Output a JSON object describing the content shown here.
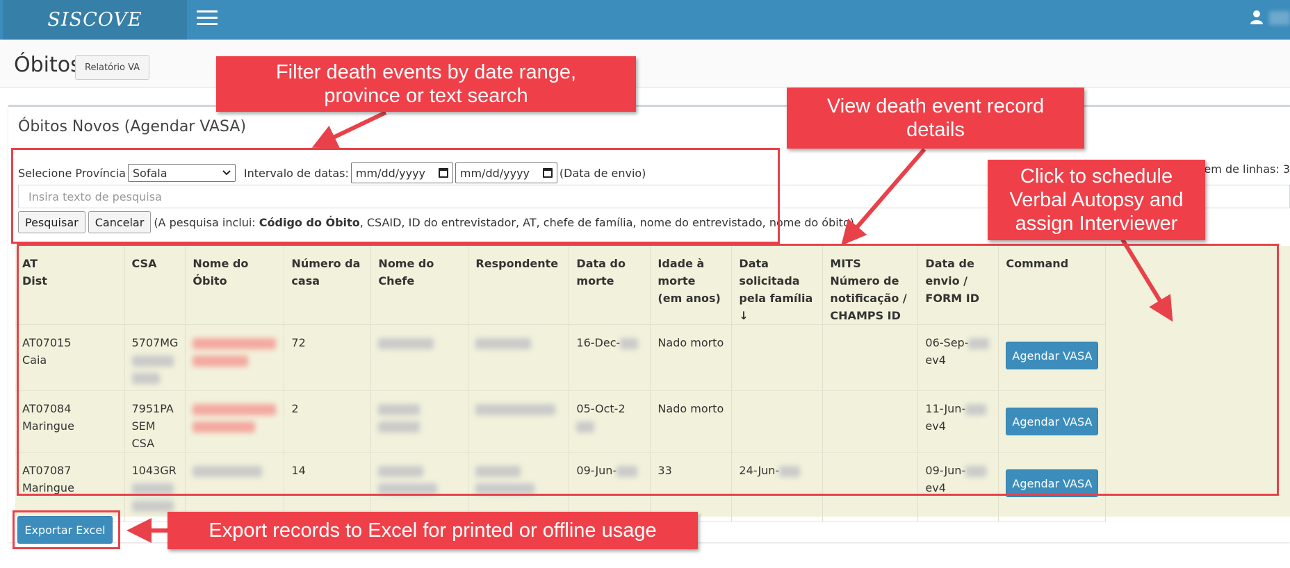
{
  "app": {
    "brand": "SISCOVE"
  },
  "header": {
    "title": "Óbitos",
    "report_button": "Relatório VA"
  },
  "box": {
    "title": "Óbitos Novos (Agendar VASA)"
  },
  "filters": {
    "province_label": "Selecione Província",
    "province_value": "Sofala",
    "date_range_label": "Intervalo de datas:",
    "date_from": "mm/dd/yyyy",
    "date_to": "mm/dd/yyyy",
    "date_note": "(Data de envio)",
    "search_placeholder": "Insira texto de pesquisa",
    "search_button": "Pesquisar",
    "cancel_button": "Cancelar",
    "search_hint_prefix": "(A pesquisa inclui:",
    "search_hint_bold": "Código do Óbito",
    "search_hint_rest": ", CSAID, ID do entrevistador, AT, chefe de família, nome do entrevistado, nome do óbito)",
    "rows_label": "gem de linhas: 3"
  },
  "table": {
    "columns": [
      {
        "line1": "AT",
        "line2": "Dist"
      },
      {
        "line1": "CSA"
      },
      {
        "line1": "Nome do Óbito"
      },
      {
        "line1": "Número da casa"
      },
      {
        "line1": "Nome do Chefe"
      },
      {
        "line1": "Respondente"
      },
      {
        "line1": "Data do morte"
      },
      {
        "line1": "Idade à morte",
        "line2": "(em anos)"
      },
      {
        "line1": "Data solicitada",
        "line2": "pela família ↓"
      },
      {
        "line1": "MITS Número de",
        "line2": "notificação /",
        "line3": "CHAMPS ID"
      },
      {
        "line1": "Data de envio /",
        "line2": "FORM ID"
      },
      {
        "line1": "Command"
      }
    ],
    "rows": [
      {
        "at": "AT07015",
        "dist": "Caia",
        "csa": "5707MG",
        "house": "72",
        "death_date": "16-Dec-",
        "age": "Nado morto",
        "req_date": "",
        "sent": "06-Sep-",
        "form": "ev4",
        "action": "Agendar VASA"
      },
      {
        "at": "AT07084",
        "dist": "Maringue",
        "csa": "7951PA",
        "csa2": "SEM CSA",
        "house": "2",
        "death_date": "05-Oct-2",
        "age": "Nado morto",
        "req_date": "",
        "sent": "11-Jun-",
        "form": "ev4",
        "action": "Agendar VASA"
      },
      {
        "at": "AT07087",
        "dist": "Maringue",
        "csa": "1043GR",
        "house": "14",
        "death_date": "09-Jun-",
        "age": "33",
        "req_date": "24-Jun-",
        "sent": "09-Jun-",
        "form": "ev4",
        "action": "Agendar VASA"
      }
    ]
  },
  "export_button": "Exportar Excel",
  "annotations": {
    "filter": {
      "line1": "Filter death events by date range,",
      "line2": "province or text search"
    },
    "details": {
      "line1": "View death event record",
      "line2": "details"
    },
    "schedule": {
      "line1": "Click to schedule",
      "line2": "Verbal Autopsy and",
      "line3": "assign Interviewer"
    },
    "export": "Export records to Excel for printed or offline usage"
  },
  "colors": {
    "navbar": "#3c8dbc",
    "brand_bg": "#367fa9",
    "callout": "#ef4049",
    "table_bg": "#f2f2dc"
  }
}
